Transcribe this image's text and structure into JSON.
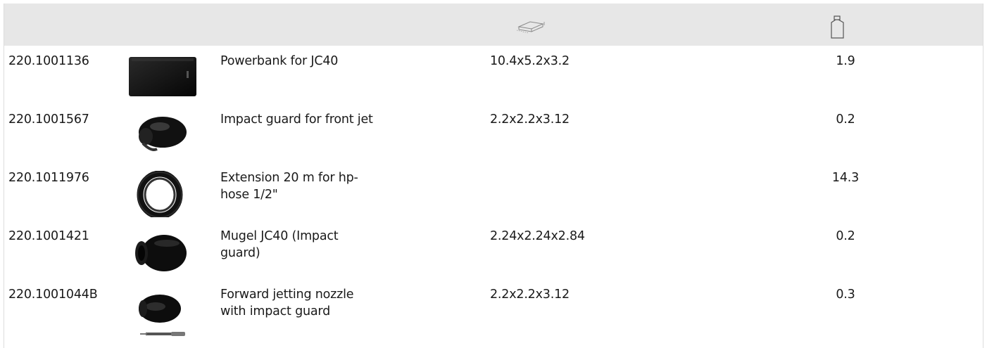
{
  "header": {
    "dimensions_icon": "box-dimensions-icon",
    "weight_icon": "weight-icon",
    "background_color": "#e7e7e7"
  },
  "rows": [
    {
      "code": "220.1001136",
      "description": "Powerbank for JC40",
      "dimensions": "10.4x5.2x3.2",
      "weight": "1.9",
      "image_icon": "powerbank-image"
    },
    {
      "code": "220.1001567",
      "description": "Impact guard for front jet",
      "dimensions": "2.2x2.2x3.12",
      "weight": "0.2",
      "image_icon": "impact-guard-image"
    },
    {
      "code": "220.1011976",
      "description": "Extension 20 m for hp-\nhose 1/2\"",
      "dimensions": "",
      "weight": "14.3",
      "image_icon": "hose-coil-image"
    },
    {
      "code": "220.1001421",
      "description": "Mugel JC40 (Impact\nguard)",
      "dimensions": "2.24x2.24x2.84",
      "weight": "0.2",
      "image_icon": "mugel-image"
    },
    {
      "code": "220.1001044B",
      "description": "Forward jetting nozzle\nwith impact guard",
      "dimensions": "2.2x2.2x3.12",
      "weight": "0.3",
      "image_icon": "forward-nozzle-image"
    }
  ]
}
